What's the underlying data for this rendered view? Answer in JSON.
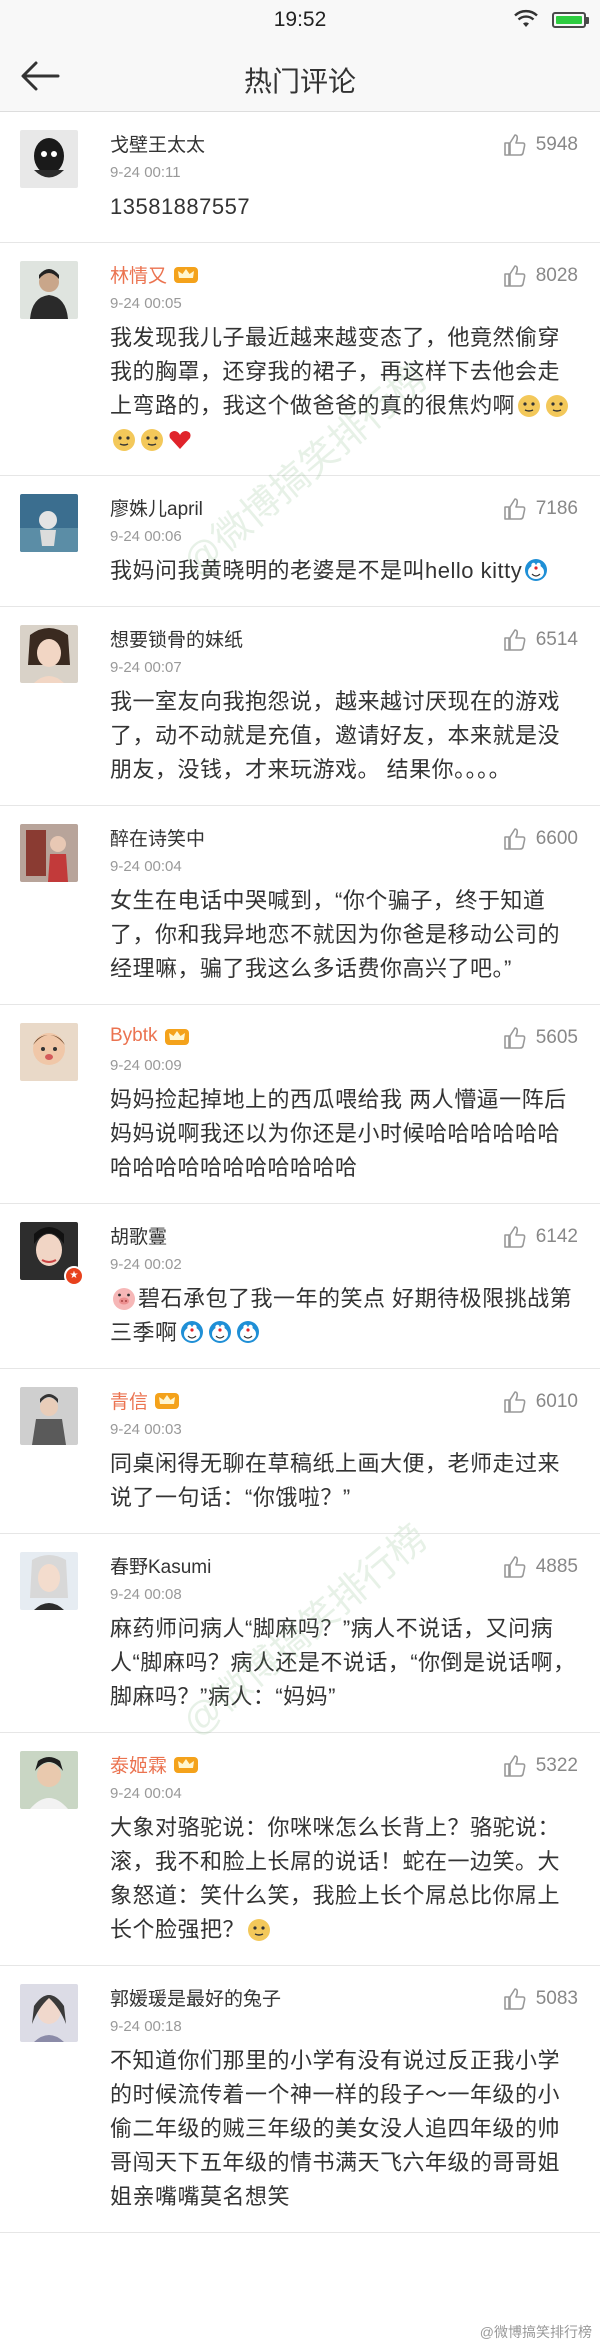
{
  "status_bar": {
    "time": "19:52"
  },
  "header": {
    "title": "热门评论"
  },
  "watermark": "@微博搞笑排行榜",
  "comments": [
    {
      "name": "戈壁王太太",
      "vip": false,
      "time": "9-24 00:11",
      "likes": "5948",
      "text": "13581887557"
    },
    {
      "name": "林情又",
      "vip": true,
      "time": "9-24 00:05",
      "likes": "8028",
      "text": "我发现我儿子最近越来越变态了，他竟然偷穿我的胸罩，还穿我的裙子，再这样下去他会走上弯路的，我这个做爸爸的真的很焦灼啊"
    },
    {
      "name": "廖姝儿april",
      "vip": false,
      "time": "9-24 00:06",
      "likes": "7186",
      "text": "我妈问我黄晓明的老婆是不是叫hello kitty"
    },
    {
      "name": "想要锁骨的妹纸",
      "vip": false,
      "time": "9-24 00:07",
      "likes": "6514",
      "text": "我一室友向我抱怨说，越来越讨厌现在的游戏了，动不动就是充值，邀请好友，本来就是没朋友，没钱，才来玩游戏。 结果你。。。。"
    },
    {
      "name": "醉在诗笑中",
      "vip": false,
      "time": "9-24 00:04",
      "likes": "6600",
      "text": "女生在电话中哭喊到，“你个骗子，终于知道了，你和我异地恋不就因为你爸是移动公司的经理嘛，骗了我这么多话费你高兴了吧。”"
    },
    {
      "name": "Bybtk",
      "vip": true,
      "time": "9-24 00:09",
      "likes": "5605",
      "text": "妈妈捡起掉地上的西瓜喂给我  两人懵逼一阵后 妈妈说啊我还以为你还是小时候哈哈哈哈哈哈哈哈哈哈哈哈哈哈哈哈哈"
    },
    {
      "name": "胡歌霻",
      "vip": false,
      "time": "9-24 00:02",
      "likes": "6142",
      "text": "碧石承包了我一年的笑点 好期待极限挑战第三季啊"
    },
    {
      "name": "青信",
      "vip": true,
      "time": "9-24 00:03",
      "likes": "6010",
      "text": "同桌闲得无聊在草稿纸上画大便，老师走过来说了一句话：“你饿啦？”"
    },
    {
      "name": "春野Kasumi",
      "vip": false,
      "time": "9-24 00:08",
      "likes": "4885",
      "text": "麻药师问病人“脚麻吗？”病人不说话，又问病人“脚麻吗？病人还是不说话，“你倒是说话啊，脚麻吗？”病人：“妈妈”"
    },
    {
      "name": "泰姬霖",
      "vip": true,
      "time": "9-24 00:04",
      "likes": "5322",
      "text": "大象对骆驼说：你咪咪怎么长背上？骆驼说：滚，我不和脸上长屌的说话！蛇在一边笑。大象怒道：笑什么笑，我脸上长个屌总比你屌上长个脸强把？"
    },
    {
      "name": "郭媛瑗是最好的兔子",
      "vip": false,
      "time": "9-24 00:18",
      "likes": "5083",
      "text": "不知道你们那里的小学有没有说过反正我小学的时候流传着一个神一样的段子～一年级的小偷二年级的贼三年级的美女没人追四年级的帅哥闯天下五年级的情书满天飞六年级的哥哥姐姐亲嘴嘴莫名想笑"
    }
  ],
  "footer": {
    "credit": "@微博搞笑排行榜"
  },
  "colors": {
    "accent": "#eb7350",
    "text": "#333333",
    "meta": "#999999"
  }
}
